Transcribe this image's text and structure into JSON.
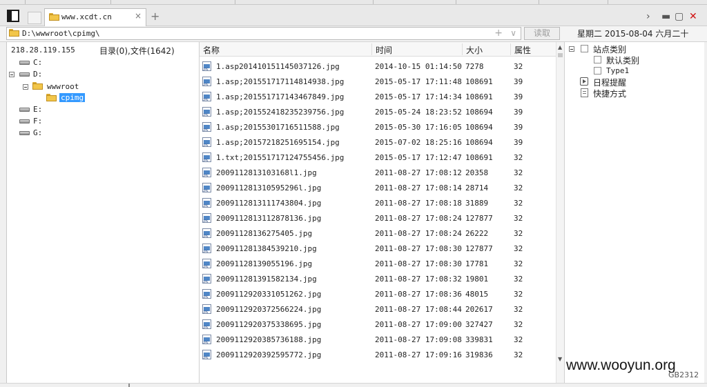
{
  "tab": {
    "title": "www.xcdt.cn",
    "close": "×"
  },
  "new_tab": "+",
  "address": {
    "path": "D:\\wwwroot\\cpimg\\",
    "plus": "+",
    "dropdown": "∨",
    "read_button": "读取"
  },
  "date_display": "星期二 2015-08-04 六月二十",
  "left": {
    "ip": "218.28.119.155",
    "dir_info": "目录(0),文件(1642)",
    "tree": {
      "c": "C:",
      "d": "D:",
      "wwwroot": "wwwroot",
      "cpimg": "cpimg",
      "e": "E:",
      "f": "F:",
      "g": "G:"
    }
  },
  "columns": {
    "name": "名称",
    "time": "时间",
    "size": "大小",
    "attr": "属性"
  },
  "files": [
    {
      "name": "1.asp201410151145037126.jpg",
      "time": "2014-10-15 01:14:50",
      "size": "7278",
      "attr": "32"
    },
    {
      "name": "1.asp;201551717114814938.jpg",
      "time": "2015-05-17 17:11:48",
      "size": "108691",
      "attr": "39"
    },
    {
      "name": "1.asp;201551717143467849.jpg",
      "time": "2015-05-17 17:14:34",
      "size": "108691",
      "attr": "39"
    },
    {
      "name": "1.asp;201552418235239756.jpg",
      "time": "2015-05-24 18:23:52",
      "size": "108694",
      "attr": "39"
    },
    {
      "name": "1.asp;20155301716511588.jpg",
      "time": "2015-05-30 17:16:05",
      "size": "108694",
      "attr": "39"
    },
    {
      "name": "1.asp;20157218251695154.jpg",
      "time": "2015-07-02 18:25:16",
      "size": "108694",
      "attr": "39"
    },
    {
      "name": "1.txt;201551717124755456.jpg",
      "time": "2015-05-17 17:12:47",
      "size": "108691",
      "attr": "32"
    },
    {
      "name": "2009112813103168l1.jpg",
      "time": "2011-08-27 17:08:12",
      "size": "20358",
      "attr": "32"
    },
    {
      "name": "200911281310595296l.jpg",
      "time": "2011-08-27 17:08:14",
      "size": "28714",
      "attr": "32"
    },
    {
      "name": "2009112813111743804.jpg",
      "time": "2011-08-27 17:08:18",
      "size": "31889",
      "attr": "32"
    },
    {
      "name": "2009112813112878136.jpg",
      "time": "2011-08-27 17:08:24",
      "size": "127877",
      "attr": "32"
    },
    {
      "name": "20091128136275405.jpg",
      "time": "2011-08-27 17:08:24",
      "size": "26222",
      "attr": "32"
    },
    {
      "name": "200911281384539210.jpg",
      "time": "2011-08-27 17:08:30",
      "size": "127877",
      "attr": "32"
    },
    {
      "name": "20091128139055196.jpg",
      "time": "2011-08-27 17:08:30",
      "size": "17781",
      "attr": "32"
    },
    {
      "name": "200911281391582134.jpg",
      "time": "2011-08-27 17:08:32",
      "size": "19801",
      "attr": "32"
    },
    {
      "name": "2009112920331051262.jpg",
      "time": "2011-08-27 17:08:36",
      "size": "48015",
      "attr": "32"
    },
    {
      "name": "2009112920372566224.jpg",
      "time": "2011-08-27 17:08:44",
      "size": "202617",
      "attr": "32"
    },
    {
      "name": "2009112920375338695.jpg",
      "time": "2011-08-27 17:09:00",
      "size": "327427",
      "attr": "32"
    },
    {
      "name": "2009112920385736188.jpg",
      "time": "2011-08-27 17:09:08",
      "size": "339831",
      "attr": "32"
    },
    {
      "name": "2009112920392595772.jpg",
      "time": "2011-08-27 17:09:16",
      "size": "319836",
      "attr": "32"
    }
  ],
  "right": {
    "site_category": "站点类别",
    "default_category": "默认类别",
    "type1": "Type1",
    "schedule": "日程提醒",
    "shortcuts": "快捷方式"
  },
  "watermark": "www.wooyun.org",
  "encoding": "GB2312"
}
